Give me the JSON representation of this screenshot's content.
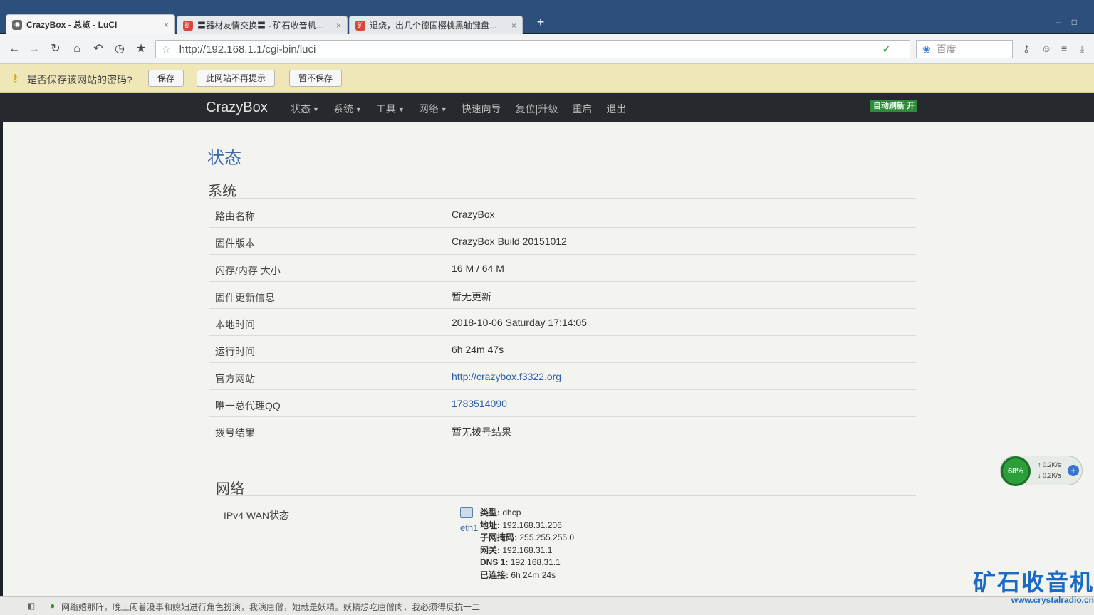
{
  "browser": {
    "tabs": [
      {
        "title": "CrazyBox - 总览 - LuCI",
        "active": true
      },
      {
        "title": "〓器材友情交换〓 - 矿石收音机...",
        "active": false
      },
      {
        "title": "退烧，出几个德国樱桃黑轴键盘...",
        "active": false
      }
    ],
    "new_tab": "+",
    "url": "http://192.168.1.1/cgi-bin/luci",
    "search_placeholder": "百度"
  },
  "password_prompt": {
    "message": "是否保存该网站的密码?",
    "save": "保存",
    "never": "此网站不再提示",
    "not_now": "暂不保存"
  },
  "luci": {
    "brand": "CrazyBox",
    "menu": [
      {
        "label": "状态",
        "dropdown": true
      },
      {
        "label": "系统",
        "dropdown": true
      },
      {
        "label": "工具",
        "dropdown": true
      },
      {
        "label": "网络",
        "dropdown": true
      },
      {
        "label": "快速向导",
        "dropdown": false
      },
      {
        "label": "复位|升级",
        "dropdown": false
      },
      {
        "label": "重启",
        "dropdown": false
      },
      {
        "label": "退出",
        "dropdown": false
      }
    ],
    "auto_refresh": "自动刷新 开"
  },
  "page": {
    "title": "状态",
    "system_section": "系统",
    "system_rows": [
      {
        "label": "路由名称",
        "value": "CrazyBox"
      },
      {
        "label": "固件版本",
        "value": "CrazyBox Build 20151012"
      },
      {
        "label": "闪存/内存 大小",
        "value": "16 M / 64 M"
      },
      {
        "label": "固件更新信息",
        "value": "暂无更新"
      },
      {
        "label": "本地时间",
        "value": "2018-10-06 Saturday 17:14:05"
      },
      {
        "label": "运行时间",
        "value": "6h 24m 47s"
      },
      {
        "label": "官方网站",
        "value": "http://crazybox.f3322.org"
      },
      {
        "label": "唯一总代理QQ",
        "value": "1783514090"
      },
      {
        "label": "拨号结果",
        "value": "暂无拨号结果"
      }
    ],
    "network_section": "网络",
    "wan": {
      "label": "IPv4 WAN状态",
      "iface": "eth1",
      "type_label": "类型:",
      "type": "dhcp",
      "addr_label": "地址:",
      "addr": "192.168.31.206",
      "mask_label": "子网掩码:",
      "mask": "255.255.255.0",
      "gw_label": "网关:",
      "gw": "192.168.31.1",
      "dns_label": "DNS 1:",
      "dns": "192.168.31.1",
      "conn_label": "已连接:",
      "conn": "6h 24m 24s"
    }
  },
  "speed_widget": {
    "percent": "68%",
    "up": "0.2K/s",
    "down": "0.2K/s"
  },
  "status_bar": {
    "news": "网络婚那阵，晚上闲着没事和媳妇进行角色扮演，我演唐僧，她就是妖精。妖精想吃唐僧肉，我必须得反抗一二"
  },
  "watermark": {
    "title": "矿石收音机",
    "url": "www.crystalradio.cn"
  },
  "colors": {
    "accent": "#3d6aa8",
    "header_bg": "#262a2e",
    "refresh_badge": "#2f8a3a"
  }
}
